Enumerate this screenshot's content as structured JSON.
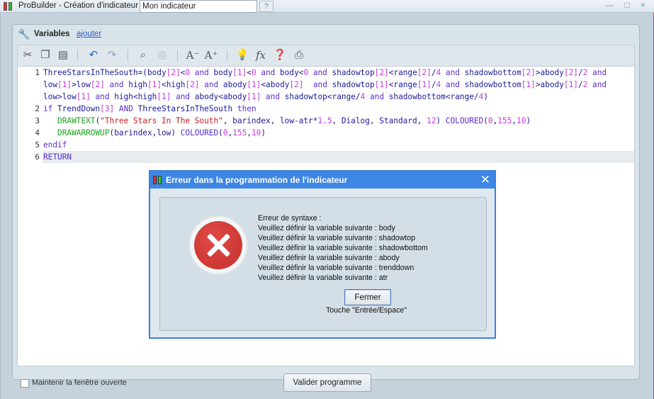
{
  "window": {
    "title": "ProBuilder - Création d'indicateur  -",
    "indicator_name": "Mon indicateur",
    "help": "?",
    "controls": "— □ ×"
  },
  "panel": {
    "variables_label": "Variables",
    "add_link": "ajouter"
  },
  "toolbar": {
    "icons": [
      "cut-icon",
      "copy-icon",
      "paste-icon",
      "undo-icon",
      "redo-icon",
      "search-icon",
      "comment-icon",
      "decrease-font-icon",
      "increase-font-icon",
      "bulb-icon",
      "function-icon",
      "help-icon",
      "print-icon"
    ]
  },
  "editor": {
    "lines": [
      {
        "num": "1",
        "text": "ThreeStarsInTheSouth=(body[2]<0 and body[1]<0 and body<0 and shadowtop[2]<range[2]/4 and shadowbottom[2]>abody[2]/2 and"
      },
      {
        "num": "",
        "text": "low[1]>low[2] and high[1]<high[2] and abody[1]<abody[2]  and shadowtop[1]<range[1]/4 and shadowbottom[1]>abody[1]/2 and"
      },
      {
        "num": "",
        "text": "low>low[1] and high<high[1] and abody<abody[1] and shadowtop<range/4 and shadowbottom<range/4)"
      },
      {
        "num": "2",
        "text": "if TrendDown[3] AND ThreeStarsInTheSouth then"
      },
      {
        "num": "3",
        "text": "   DRAWTEXT(\"Three Stars In The South\", barindex, low-atr*1.5, Dialog, Standard, 12) COLOURED(0,155,10)"
      },
      {
        "num": "4",
        "text": "   DRAWARROWUP(barindex,low) COLOURED(0,155,10)"
      },
      {
        "num": "5",
        "text": "endif"
      },
      {
        "num": "6",
        "text": "RETURN"
      }
    ]
  },
  "footer": {
    "keep_open_label": "Maintenir la fenêtre ouverte",
    "validate_label": "Valider programme"
  },
  "dialog": {
    "title": "Erreur dans la programmation de l'indicateur",
    "close_x": "✕",
    "messages": [
      "Erreur de syntaxe :",
      "Veuillez définir la variable suivante : body",
      "Veuillez définir la variable suivante : shadowtop",
      "Veuillez définir la variable suivante : shadowbottom",
      "Veuillez définir la variable suivante : abody",
      "Veuillez définir la variable suivante : trenddown",
      "Veuillez définir la variable suivante : atr"
    ],
    "close_button": "Fermer",
    "key_hint": "Touche \"Entrée/Espace\""
  }
}
